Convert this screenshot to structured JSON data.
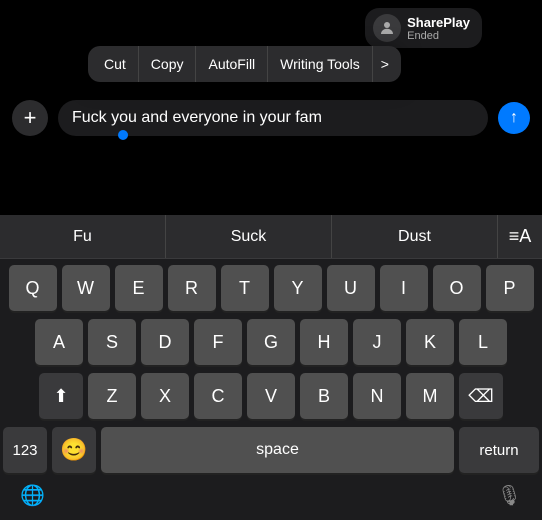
{
  "shareplay": {
    "title": "SharePlay",
    "subtitle": "Ended"
  },
  "context_menu": {
    "items": [
      "Cut",
      "Copy",
      "AutoFill",
      "Writing Tools"
    ],
    "arrow": ">"
  },
  "input": {
    "text": "Fuck you and everyone in your fam",
    "placeholder": ""
  },
  "autocorrect": {
    "items": [
      "Fu",
      "Suck",
      "Dust"
    ],
    "icon": "≡A"
  },
  "keyboard": {
    "row1": [
      "Q",
      "W",
      "E",
      "R",
      "T",
      "Y",
      "U",
      "I",
      "O",
      "P"
    ],
    "row2": [
      "A",
      "S",
      "D",
      "F",
      "G",
      "H",
      "J",
      "K",
      "L"
    ],
    "row3": [
      "Z",
      "X",
      "C",
      "V",
      "B",
      "N",
      "M"
    ],
    "shift_icon": "⬆",
    "backspace_icon": "⌫",
    "bottom": {
      "numbers": "123",
      "emoji": "😊",
      "space": "space",
      "return": "return"
    },
    "globe_icon": "🌐",
    "mic_icon": "🎙"
  },
  "add_button": "+",
  "send_button": "↑"
}
